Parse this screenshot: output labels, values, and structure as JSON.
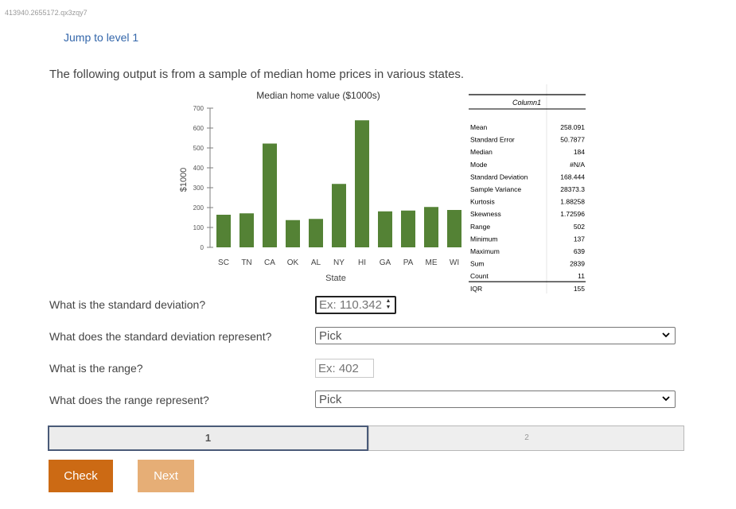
{
  "header": {
    "session_id": "413940.2655172.qx3zqy7",
    "jump_link": "Jump to level 1"
  },
  "intro_text": "The following output is from a sample of median home prices in various states.",
  "chart_data": {
    "type": "bar",
    "title": "Median home value ($1000s)",
    "xlabel": "State",
    "ylabel": "$1000",
    "categories": [
      "SC",
      "TN",
      "CA",
      "OK",
      "AL",
      "NY",
      "HI",
      "GA",
      "PA",
      "ME",
      "WI"
    ],
    "values": [
      164,
      171,
      522,
      137,
      143,
      319,
      639,
      181,
      185,
      203,
      188
    ],
    "yticks": [
      0,
      100,
      200,
      300,
      400,
      500,
      600,
      700
    ],
    "ylim": [
      0,
      700
    ],
    "bar_color": "#548235",
    "grid": false
  },
  "stats_table": {
    "header": "Column1",
    "rows": [
      {
        "label": "Mean",
        "value": "258.091"
      },
      {
        "label": "Standard Error",
        "value": "50.7877"
      },
      {
        "label": "Median",
        "value": "184"
      },
      {
        "label": "Mode",
        "value": "#N/A"
      },
      {
        "label": "Standard Deviation",
        "value": "168.444"
      },
      {
        "label": "Sample Variance",
        "value": "28373.3"
      },
      {
        "label": "Kurtosis",
        "value": "1.88258"
      },
      {
        "label": "Skewness",
        "value": "1.72596"
      },
      {
        "label": "Range",
        "value": "502"
      },
      {
        "label": "Minimum",
        "value": "137"
      },
      {
        "label": "Maximum",
        "value": "639"
      },
      {
        "label": "Sum",
        "value": "2839"
      },
      {
        "label": "Count",
        "value": "11"
      },
      {
        "label": "IQR",
        "value": "155"
      }
    ]
  },
  "questions": {
    "q1": "What is the standard deviation?",
    "q1_placeholder": "Ex: 110.342",
    "q2": "What does the standard deviation represent?",
    "q2_selected": "Pick",
    "q3": "What is the range?",
    "q3_placeholder": "Ex: 402",
    "q4": "What does the range represent?",
    "q4_selected": "Pick"
  },
  "progress": {
    "level_1": "1",
    "level_2": "2"
  },
  "buttons": {
    "check": "Check",
    "next": "Next"
  },
  "colors": {
    "accent": "#cc6a14",
    "accent_disabled": "#e6ae76",
    "link": "#3366aa",
    "bar": "#548235"
  }
}
